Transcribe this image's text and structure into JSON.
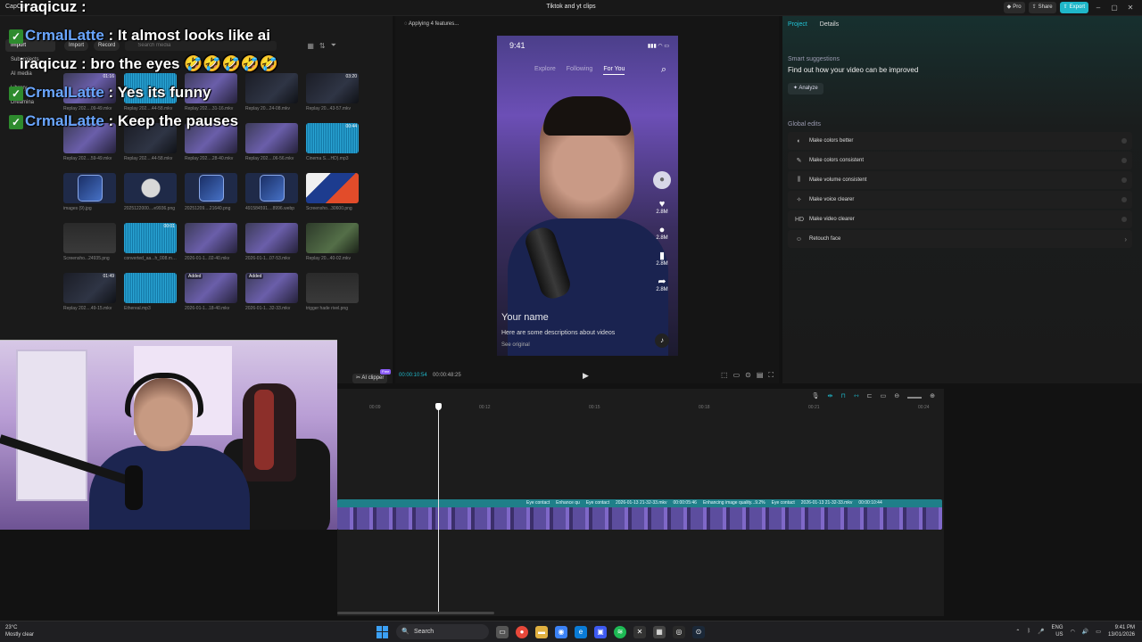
{
  "window": {
    "app_name": "CapCut",
    "title": "Tiktok and yt clips",
    "pro_label": "Pro",
    "share_label": "Share",
    "export_label": "Export"
  },
  "media_panel": {
    "sidebar": [
      {
        "label": "Import"
      },
      {
        "label": "Subprojects"
      },
      {
        "label": "AI media"
      },
      {
        "label": "Library"
      },
      {
        "label": "Dreamina"
      }
    ],
    "import_label": "Import",
    "record_label": "Record",
    "search_placeholder": "Search media",
    "items": [
      {
        "name": "Replay 202....09-49.mkv",
        "duration": "01:16",
        "kind": "video",
        "badge": ""
      },
      {
        "name": "Replay 202....44-58.mkv",
        "duration": "",
        "kind": "audio",
        "badge": ""
      },
      {
        "name": "Replay 202....31-16.mkv",
        "duration": "",
        "kind": "video",
        "badge": ""
      },
      {
        "name": "Replay 20...24-08.mkv",
        "duration": "",
        "kind": "dark",
        "badge": ""
      },
      {
        "name": "Replay 20...43-57.mkv",
        "duration": "03:20",
        "kind": "dark",
        "badge": ""
      },
      {
        "name": "Replay 202....59-49.mkv",
        "duration": "",
        "kind": "video",
        "badge": ""
      },
      {
        "name": "Replay 202....44-58.mkv",
        "duration": "",
        "kind": "dark",
        "badge": ""
      },
      {
        "name": "Replay 202....28-40.mkv",
        "duration": "",
        "kind": "video",
        "badge": ""
      },
      {
        "name": "Replay 202....06-56.mkv",
        "duration": "",
        "kind": "video",
        "badge": ""
      },
      {
        "name": "Cinema S....HD).mp3",
        "duration": "00:44",
        "kind": "audio",
        "badge": ""
      },
      {
        "name": "images (9).jpg",
        "duration": "",
        "kind": "icon",
        "badge": ""
      },
      {
        "name": "2025122000....e9936.png",
        "duration": "",
        "kind": "moon",
        "badge": ""
      },
      {
        "name": "20251209....21640.png",
        "duration": "",
        "kind": "icon",
        "badge": ""
      },
      {
        "name": "491584591....8996.webp",
        "duration": "",
        "kind": "icon",
        "badge": ""
      },
      {
        "name": "Screensho...30600.png",
        "duration": "",
        "kind": "orange",
        "badge": ""
      },
      {
        "name": "Screensho...24935.png",
        "duration": "",
        "kind": "gray",
        "badge": ""
      },
      {
        "name": "converted_aa...h_008.mp3",
        "duration": "00:01",
        "kind": "audio",
        "badge": ""
      },
      {
        "name": "2026-01-1...02-40.mkv",
        "duration": "",
        "kind": "video",
        "badge": ""
      },
      {
        "name": "2026-01-1...07-53.mkv",
        "duration": "",
        "kind": "video",
        "badge": ""
      },
      {
        "name": "Replay 20...40-02.mkv",
        "duration": "",
        "kind": "green",
        "badge": ""
      },
      {
        "name": "Replay 202....49-15.mkv",
        "duration": "01:49",
        "kind": "dark",
        "badge": ""
      },
      {
        "name": "Ethereal.mp3",
        "duration": "",
        "kind": "audio",
        "badge": ""
      },
      {
        "name": "2026-01-1...18-40.mkv",
        "duration": "",
        "kind": "video",
        "badge": "Added"
      },
      {
        "name": "2026-01-1...32-33.mkv",
        "duration": "",
        "kind": "video",
        "badge": "Added"
      },
      {
        "name": "trigger hade rivel.png",
        "duration": "",
        "kind": "gray",
        "badge": ""
      }
    ]
  },
  "player": {
    "status": "Applying 4 features...",
    "phone": {
      "time": "9:41",
      "tab_explore": "Explore",
      "tab_following": "Following",
      "tab_for_you": "For You",
      "username": "Your name",
      "description": "Here are some descriptions about videos",
      "original": "See original",
      "likes": "2.8M",
      "comments": "2.8M",
      "saves": "2.8M",
      "shares": "2.8M"
    },
    "current_time": "00:00:10:54",
    "total_time": "00:00:48:25",
    "ai_clipper_label": "AI clipper",
    "ai_clipper_badge": "Free"
  },
  "properties": {
    "tab_project": "Project",
    "tab_details": "Details",
    "smart_title": "Smart suggestions",
    "smart_hint": "Find out how your video can be improved",
    "analyze_label": "Analyze",
    "global_title": "Global edits",
    "edits": [
      {
        "label": "Make colors better",
        "icon": "palette-icon"
      },
      {
        "label": "Make colors consistent",
        "icon": "brush-icon"
      },
      {
        "label": "Make volume consistent",
        "icon": "volume-icon"
      },
      {
        "label": "Make voice clearer",
        "icon": "voice-icon"
      },
      {
        "label": "Make video clearer",
        "icon": "hd-icon"
      },
      {
        "label": "Retouch face",
        "icon": "face-icon"
      }
    ]
  },
  "timeline": {
    "ruler": [
      "00:09",
      "00:12",
      "00:15",
      "00:18",
      "00:21",
      "00:24"
    ],
    "clip_labels": [
      "Eye contact",
      "Enhance qu",
      "Eye contact",
      "2026-01-13 21-32-33.mkv",
      "00:00:05:46",
      "Enhancing image quality...9.2%",
      "Eye contact",
      "2026-01-13 21-32-33.mkv",
      "00:00:10:44"
    ]
  },
  "chat": [
    {
      "user": "iraqicuz",
      "message": "",
      "badge": false,
      "user_color": "white"
    },
    {
      "user": "CrmalLatte",
      "message": "It almost looks like ai",
      "badge": true,
      "user_color": "blue"
    },
    {
      "user": "iraqicuz",
      "message": "bro the eyes 🤣🤣🤣🤣🤣",
      "badge": false,
      "user_color": "white"
    },
    {
      "user": "CrmalLatte",
      "message": "Yes its funny",
      "badge": true,
      "user_color": "blue"
    },
    {
      "user": "CrmalLatte",
      "message": "Keep the pauses",
      "badge": true,
      "user_color": "blue"
    }
  ],
  "taskbar": {
    "temp": "23°C",
    "weather": "Mostly clear",
    "search_label": "Search",
    "lang": "ENG",
    "region": "US",
    "time": "9:41 PM",
    "date": "13/01/2026"
  },
  "colors": {
    "accent": "#1fb7c9",
    "chat_user": "#6aa6ff",
    "clip": "#7f68c8"
  }
}
